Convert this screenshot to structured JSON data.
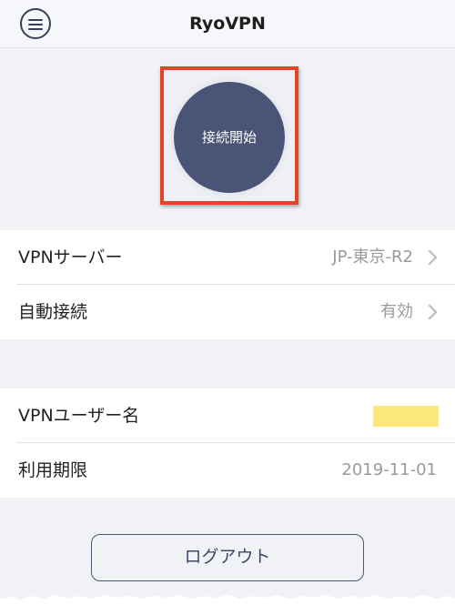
{
  "header": {
    "title": "RyoVPN",
    "menu_icon": "hamburger-menu-icon"
  },
  "connect": {
    "button_label": "接続開始"
  },
  "settings": {
    "vpn_server": {
      "label": "VPNサーバー",
      "value": "JP-東京-R2"
    },
    "auto_connect": {
      "label": "自動接続",
      "value": "有効"
    }
  },
  "account": {
    "username": {
      "label": "VPNユーザー名"
    },
    "expiry": {
      "label": "利用期限",
      "value": "2019-11-01"
    }
  },
  "logout": {
    "label": "ログアウト"
  },
  "colors": {
    "accent": "#4a5477",
    "highlight": "#e0452a",
    "redaction": "#fce87a"
  }
}
